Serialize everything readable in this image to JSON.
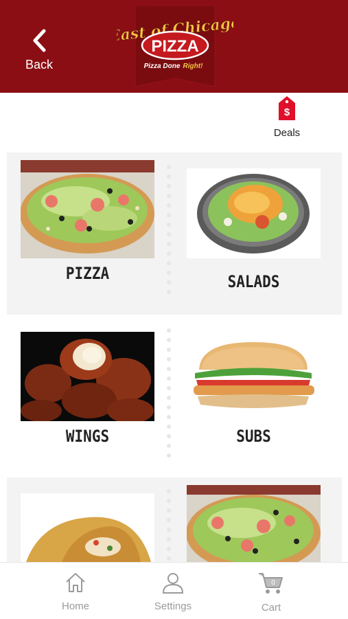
{
  "header": {
    "back_label": "Back",
    "brand_top": "East of Chicago",
    "brand_main": "PIZZA",
    "brand_tagline_a": "Pizza Done",
    "brand_tagline_b": "Right!",
    "color": "#8b0e14"
  },
  "deals": {
    "label": "Deals",
    "icon": "price-tag-icon",
    "symbol": "$"
  },
  "menu": [
    {
      "label": "PIZZA"
    },
    {
      "label": "SALADS"
    },
    {
      "label": "WINGS"
    },
    {
      "label": "SUBS"
    },
    {
      "label": ""
    },
    {
      "label": ""
    }
  ],
  "tabbar": {
    "home_label": "Home",
    "settings_label": "Settings",
    "cart_label": "Cart",
    "cart_count": "0"
  }
}
